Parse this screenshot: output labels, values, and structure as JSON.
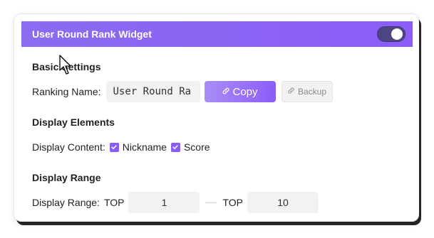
{
  "widget": {
    "title": "User Round Rank Widget",
    "enabled": true
  },
  "basic_settings": {
    "title": "Basic Settings",
    "ranking_name_label": "Ranking Name:",
    "ranking_name_value": "User Round Ra",
    "copy_label": "Copy",
    "backup_label": "Backup"
  },
  "display_elements": {
    "title": "Display Elements",
    "content_label": "Display Content:",
    "options": [
      {
        "label": "Nickname",
        "checked": true
      },
      {
        "label": "Score",
        "checked": true
      }
    ]
  },
  "display_range": {
    "title": "Display Range",
    "range_label": "Display Range:",
    "top_prefix_1": "TOP",
    "from_value": "1",
    "top_prefix_2": "TOP",
    "to_value": "10"
  },
  "colors": {
    "accent": "#8b5cf6",
    "header_gradient_start": "#8a6cf0",
    "toggle_track": "#4b4680"
  },
  "icons": {
    "copy": "link-icon",
    "backup": "link-icon",
    "check": "check-icon"
  }
}
